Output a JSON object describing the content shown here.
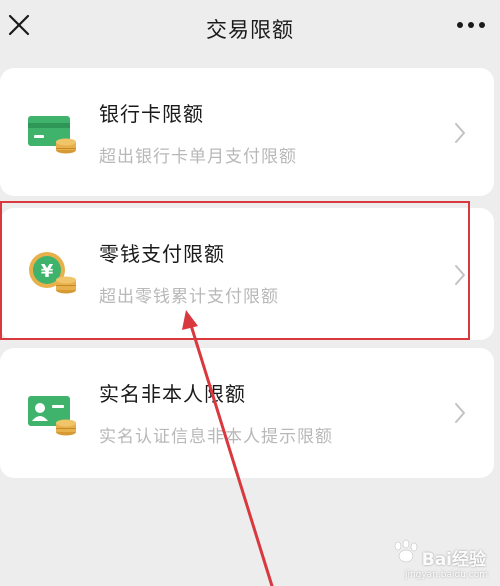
{
  "nav": {
    "title": "交易限额"
  },
  "items": [
    {
      "title": "银行卡限额",
      "subtitle": "超出银行卡单月支付限额",
      "icon": "bank-card-icon"
    },
    {
      "title": "零钱支付限额",
      "subtitle": "超出零钱累计支付限额",
      "icon": "yuan-coin-icon"
    },
    {
      "title": "实名非本人限额",
      "subtitle": "实名认证信息非本人提示限额",
      "icon": "id-card-icon"
    }
  ],
  "colors": {
    "icon_green": "#3fb36b",
    "coin_gold": "#e8b04a",
    "highlight_red": "#d9383f",
    "page_bg": "#ededed"
  },
  "watermark": {
    "text": "Bai经验",
    "sub": "jingyan.baidu.com"
  }
}
